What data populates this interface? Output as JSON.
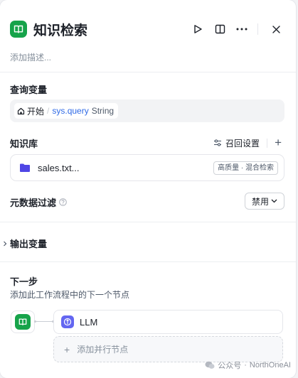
{
  "header": {
    "title": "知识检索",
    "description_placeholder": "添加描述..."
  },
  "query_variable": {
    "section_title": "查询变量",
    "source": "开始",
    "separator": "/",
    "variable_name": "sys.query",
    "variable_type": "String"
  },
  "knowledge": {
    "section_title": "知识库",
    "recall_settings_label": "召回设置",
    "add_label": "+",
    "items": [
      {
        "name": "sales.txt...",
        "badge": "高质量 · 混合检索"
      }
    ]
  },
  "metadata_filter": {
    "label": "元数据过滤",
    "selected": "禁用"
  },
  "output": {
    "label": "输出变量"
  },
  "next_step": {
    "title": "下一步",
    "description": "添加此工作流程中的下一个节点",
    "next_node_label": "LLM",
    "add_parallel_label": "添加并行节点"
  },
  "watermark": {
    "text": "公众号",
    "dot": "·",
    "account": "NorthOneAI"
  },
  "colors": {
    "accent_green": "#16a34a",
    "link_blue": "#2f6ae6",
    "llm_purple": "#6366f1"
  }
}
